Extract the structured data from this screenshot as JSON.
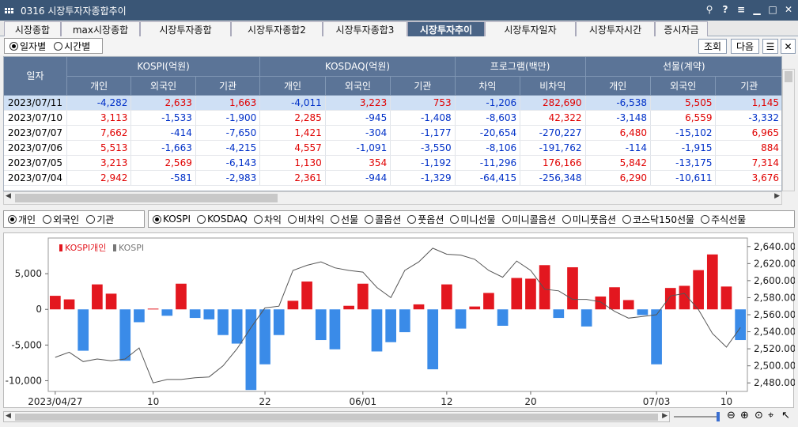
{
  "window": {
    "title": "0316 시장투자자종합추이"
  },
  "tabs": [
    "시장종합",
    "max시장종합",
    "시장투자종합",
    "시장투자종합2",
    "시장투자종합3",
    "시장투자추이",
    "시장투자일자",
    "시장투자시간",
    "증시자금"
  ],
  "active_tab": 5,
  "view_mode": {
    "options": [
      "일자별",
      "시간별"
    ],
    "selected": 0
  },
  "buttons": {
    "query": "조회",
    "next": "다음"
  },
  "table": {
    "date_header": "일자",
    "groups": [
      "KOSPI(억원)",
      "KOSDAQ(억원)",
      "프로그램(백만)",
      "선물(계약)"
    ],
    "subheaders": [
      "개인",
      "외국인",
      "기관",
      "개인",
      "외국인",
      "기관",
      "차익",
      "비차익",
      "개인",
      "외국인",
      "기관"
    ],
    "rows": [
      {
        "date": "2023/07/11",
        "v": [
          "-4,282",
          "2,633",
          "1,663",
          "-4,011",
          "3,223",
          "753",
          "-1,206",
          "282,690",
          "-6,538",
          "5,505",
          "1,145"
        ]
      },
      {
        "date": "2023/07/10",
        "v": [
          "3,113",
          "-1,533",
          "-1,900",
          "2,285",
          "-945",
          "-1,408",
          "-8,603",
          "42,322",
          "-3,148",
          "6,559",
          "-3,332"
        ]
      },
      {
        "date": "2023/07/07",
        "v": [
          "7,662",
          "-414",
          "-7,650",
          "1,421",
          "-304",
          "-1,177",
          "-20,654",
          "-270,227",
          "6,480",
          "-15,102",
          "6,965"
        ]
      },
      {
        "date": "2023/07/06",
        "v": [
          "5,513",
          "-1,663",
          "-4,215",
          "4,557",
          "-1,091",
          "-3,550",
          "-8,106",
          "-191,762",
          "-114",
          "-1,915",
          "884"
        ]
      },
      {
        "date": "2023/07/05",
        "v": [
          "3,213",
          "2,569",
          "-6,143",
          "1,130",
          "354",
          "-1,192",
          "-11,296",
          "176,166",
          "5,842",
          "-13,175",
          "7,314"
        ]
      },
      {
        "date": "2023/07/04",
        "v": [
          "2,942",
          "-581",
          "-2,983",
          "2,361",
          "-944",
          "-1,329",
          "-64,415",
          "-256,348",
          "6,290",
          "-10,611",
          "3,676"
        ]
      }
    ]
  },
  "investor_options": {
    "items": [
      "개인",
      "외국인",
      "기관"
    ],
    "selected": 0
  },
  "market_options": {
    "items": [
      "KOSPI",
      "KOSDAQ",
      "차익",
      "비차익",
      "선물",
      "콜옵션",
      "풋옵션",
      "미니선물",
      "미니콜옵션",
      "미니풋옵션",
      "코스닥150선물",
      "주식선물"
    ],
    "selected": 0
  },
  "chart_data": {
    "type": "bar+line",
    "legend": [
      "KOSPI개인",
      "KOSPI"
    ],
    "left_ticks": [
      "5,000",
      "0",
      "-5,000",
      "-10,000"
    ],
    "left_range": [
      -11500,
      10000
    ],
    "right_ticks": [
      "2,640.00",
      "2,620.00",
      "2,600.00",
      "2,580.00",
      "2,560.00",
      "2,540.00",
      "2,520.00",
      "2,500.00",
      "2,480.00"
    ],
    "right_range": [
      2470,
      2650
    ],
    "x_labels": [
      {
        "i": 0,
        "t": "2023/04/27"
      },
      {
        "i": 7,
        "t": "10"
      },
      {
        "i": 15,
        "t": "22"
      },
      {
        "i": 22,
        "t": "06/01"
      },
      {
        "i": 28,
        "t": "12"
      },
      {
        "i": 34,
        "t": "20"
      },
      {
        "i": 43,
        "t": "07/03"
      },
      {
        "i": 48,
        "t": "10"
      }
    ],
    "bars": [
      1900,
      1400,
      -5800,
      3500,
      2200,
      -7200,
      -1800,
      100,
      -900,
      3600,
      -1200,
      -1400,
      -3600,
      -4800,
      -11300,
      -7700,
      -3600,
      1200,
      3900,
      -4300,
      -5600,
      500,
      3600,
      -5900,
      -4600,
      -3200,
      700,
      -8400,
      3500,
      -2700,
      400,
      2300,
      -2300,
      4400,
      4300,
      6200,
      -1200,
      5900,
      -2400,
      1800,
      3100,
      1300,
      -800,
      -7700,
      3000,
      3300,
      5500,
      7700,
      3200,
      -4300
    ],
    "line": [
      2510,
      2516,
      2505,
      2508,
      2506,
      2508,
      2521,
      2480,
      2484,
      2484,
      2486,
      2487,
      2500,
      2520,
      2545,
      2568,
      2570,
      2612,
      2618,
      2622,
      2615,
      2612,
      2610,
      2592,
      2580,
      2612,
      2622,
      2638,
      2631,
      2630,
      2625,
      2612,
      2604,
      2623,
      2612,
      2590,
      2588,
      2578,
      2578,
      2575,
      2564,
      2556,
      2558,
      2560,
      2582,
      2585,
      2566,
      2538,
      2522,
      2545
    ]
  }
}
